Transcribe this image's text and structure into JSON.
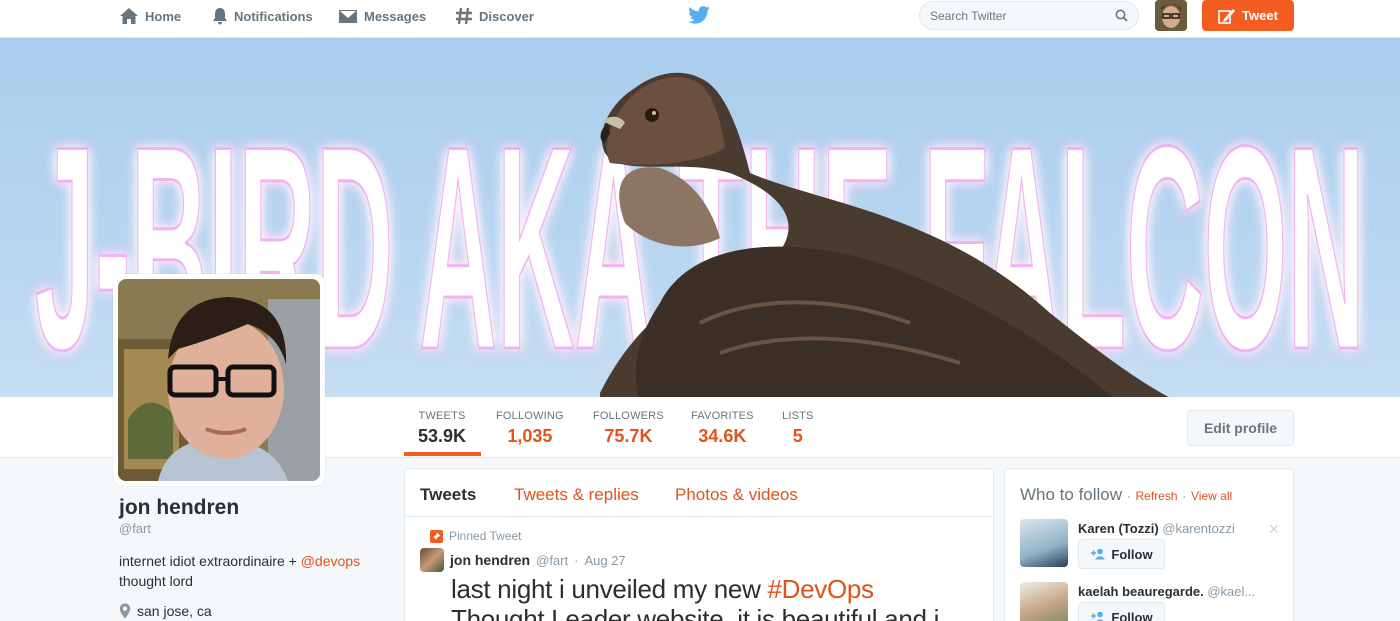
{
  "nav": {
    "home": "Home",
    "notifications": "Notifications",
    "messages": "Messages",
    "discover": "Discover",
    "search_placeholder": "Search Twitter",
    "tweet_button": "Tweet"
  },
  "banner": {
    "text": "J-BIRD AKA THE FALCON"
  },
  "stats": [
    {
      "label": "TWEETS",
      "value": "53.9K"
    },
    {
      "label": "FOLLOWING",
      "value": "1,035"
    },
    {
      "label": "FOLLOWERS",
      "value": "75.7K"
    },
    {
      "label": "FAVORITES",
      "value": "34.6K"
    },
    {
      "label": "LISTS",
      "value": "5"
    }
  ],
  "edit_profile": "Edit profile",
  "profile": {
    "name": "jon hendren",
    "handle": "@fart",
    "bio_prefix": "internet idiot extraordinaire + ",
    "bio_mention": "@devops",
    "bio_suffix": "thought lord",
    "location": "san jose, ca"
  },
  "timeline": {
    "tabs": [
      "Tweets",
      "Tweets & replies",
      "Photos & videos"
    ],
    "pinned_label": "Pinned Tweet",
    "tweet": {
      "name": "jon hendren",
      "handle": "@fart",
      "date": "Aug 27",
      "text_prefix": "last night i unveiled my new ",
      "hashtag": "#DevOps",
      "text_line2": "Thought Leader website. it is beautiful and i"
    }
  },
  "who_to_follow": {
    "title": "Who to follow",
    "refresh": "Refresh",
    "view_all": "View all",
    "follow_label": "Follow",
    "suggestions": [
      {
        "name": "Karen (Tozzi)",
        "handle": "@karentozzi"
      },
      {
        "name": "kaelah beauregarde.",
        "handle": "@kael..."
      }
    ]
  },
  "colors": {
    "accent": "#f45d22",
    "link": "#e0531d"
  }
}
